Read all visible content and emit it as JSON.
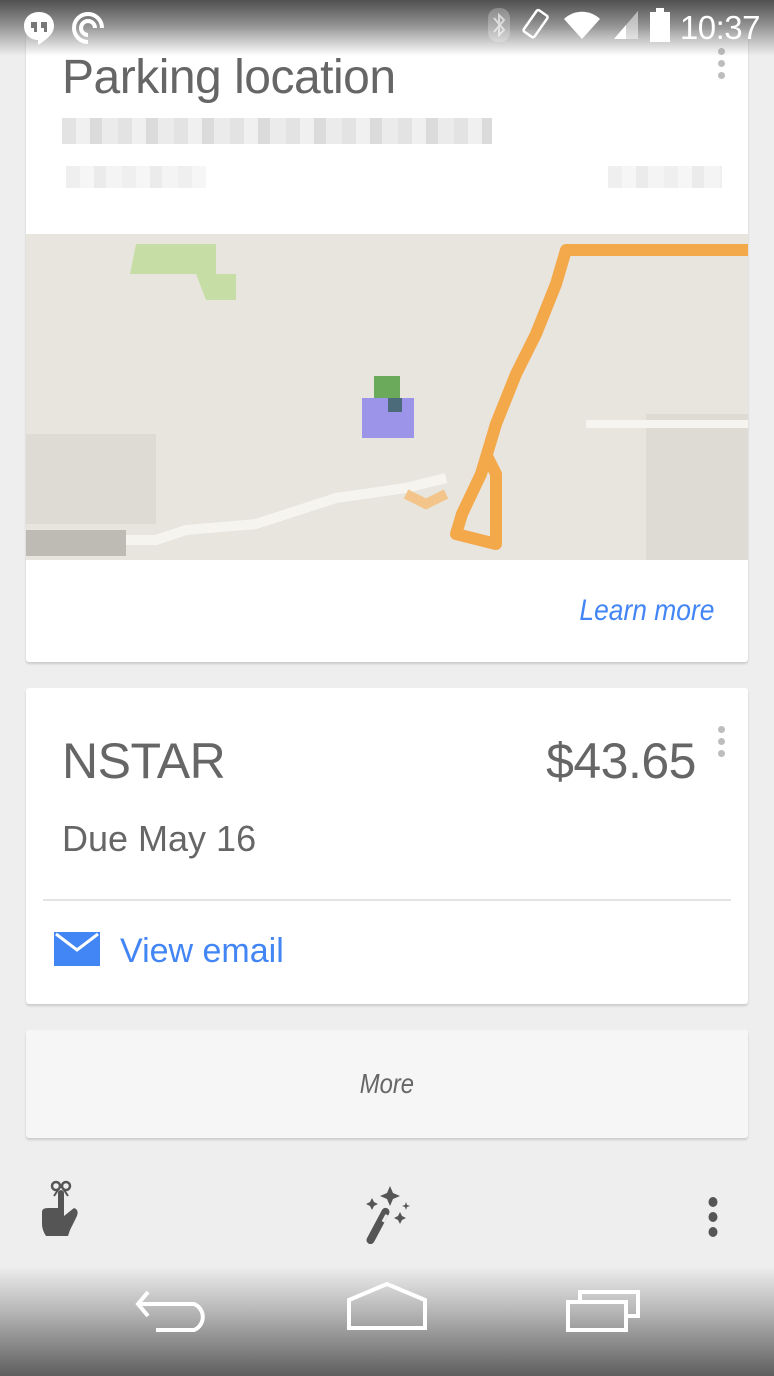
{
  "status_bar": {
    "time": "10:37",
    "left_icons": [
      "hangouts-icon",
      "pocket-casts-icon"
    ],
    "right_icons": [
      "bluetooth-icon",
      "screen-rotation-icon",
      "wifi-icon",
      "cell-signal-icon",
      "battery-icon"
    ]
  },
  "parking_card": {
    "title": "Parking location",
    "address_line": "(blurred)",
    "time_line": "(blurred)",
    "distance": "(blurred)",
    "action_label": "Learn more",
    "map": {
      "background_color": "#e8e5df",
      "route_color": "#f4a13a",
      "park_color": "#c6dea5",
      "marker_color": "#9b94e8"
    }
  },
  "bill_card": {
    "payee": "NSTAR",
    "amount": "$43.65",
    "due": "Due May 16",
    "action_label": "View email"
  },
  "more_card": {
    "label": "More"
  },
  "toolbar": {
    "items": [
      "reminder-icon",
      "customize-icon",
      "overflow-menu-icon"
    ]
  },
  "nav_bar": {
    "items": [
      "back-button",
      "home-button",
      "recents-button"
    ]
  },
  "colors": {
    "accent": "#4285f4",
    "background": "#eeeeee",
    "card": "#ffffff",
    "text": "#666666",
    "icon": "#555555"
  }
}
